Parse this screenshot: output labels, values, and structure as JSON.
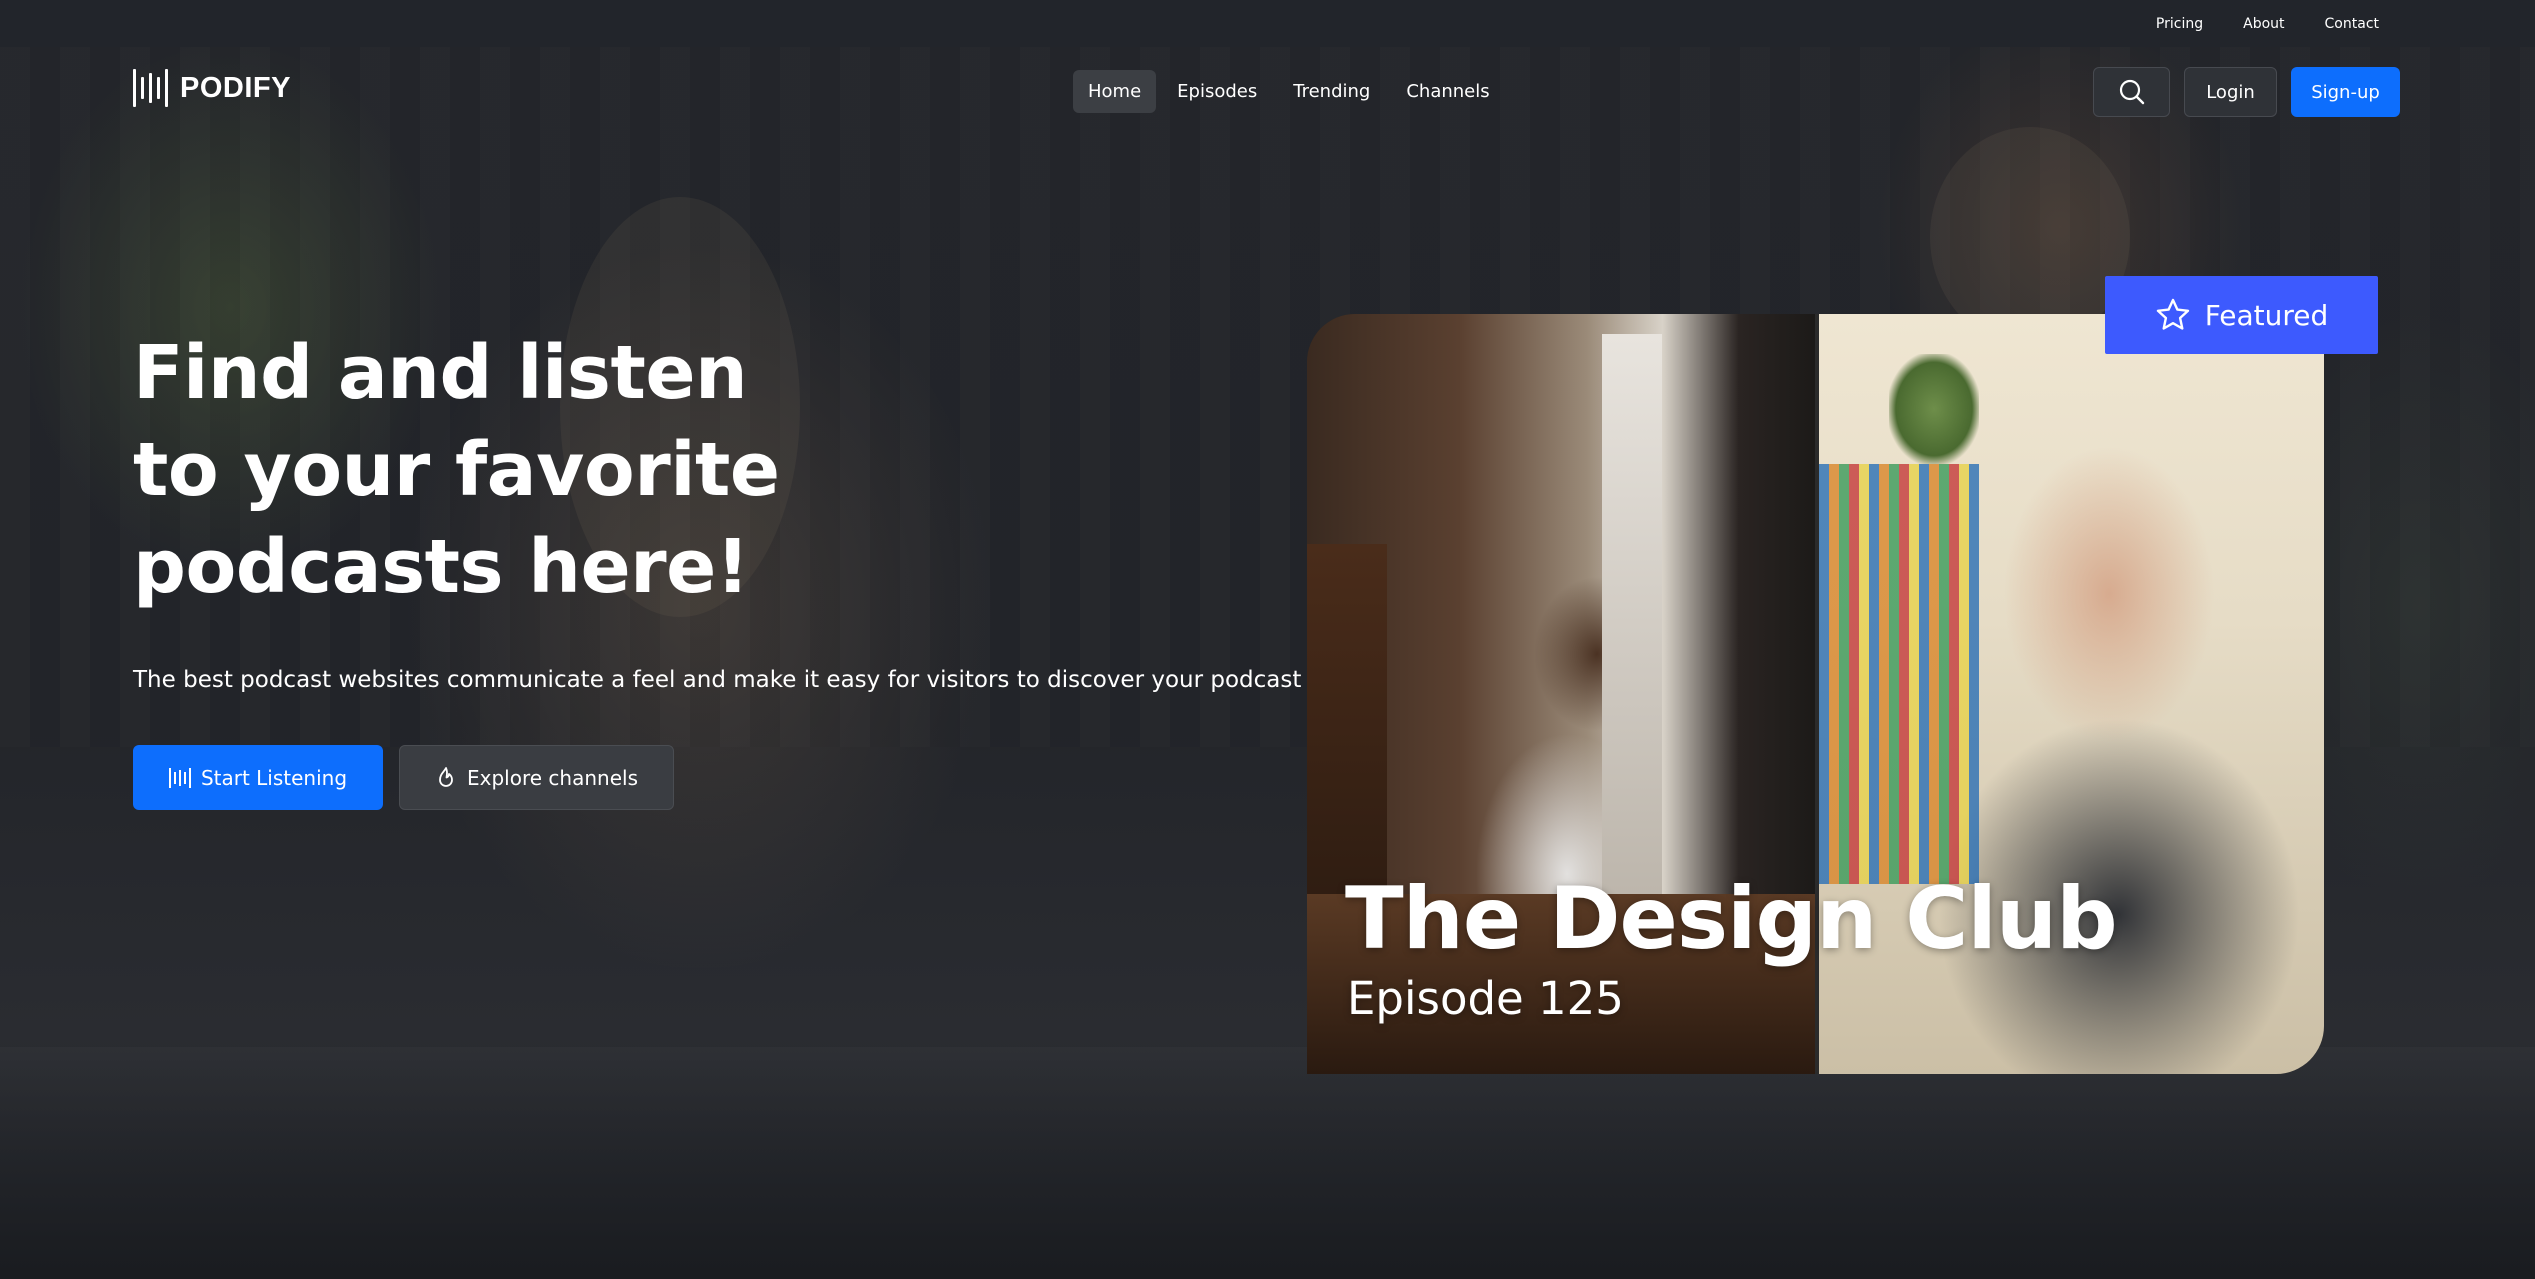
{
  "topbar": {
    "links": [
      "Pricing",
      "About",
      "Contact"
    ]
  },
  "brand": {
    "name": "PODIFY",
    "logo_icon": "waveform-icon"
  },
  "nav": {
    "items": [
      {
        "label": "Home",
        "active": true
      },
      {
        "label": "Episodes",
        "active": false
      },
      {
        "label": "Trending",
        "active": false
      },
      {
        "label": "Channels",
        "active": false
      }
    ],
    "search_icon": "search-icon",
    "login_label": "Login",
    "signup_label": "Sign-up"
  },
  "hero": {
    "title_lines": [
      "Find and listen",
      "to your favorite",
      "podcasts here!"
    ],
    "subtitle": "The best podcast websites communicate a feel and make it easy for visitors to discover your podcast",
    "primary_cta": {
      "label": "Start Listening",
      "icon": "waveform-icon"
    },
    "secondary_cta": {
      "label": "Explore channels",
      "icon": "flame-icon"
    }
  },
  "featured": {
    "badge_label": "Featured",
    "badge_icon": "star-icon",
    "show_title": "The Design Club",
    "episode": "Episode 125"
  },
  "colors": {
    "accent": "#0d6efd",
    "badge": "#3d5afe",
    "background": "#1f2228",
    "topbar": "#22252b"
  }
}
